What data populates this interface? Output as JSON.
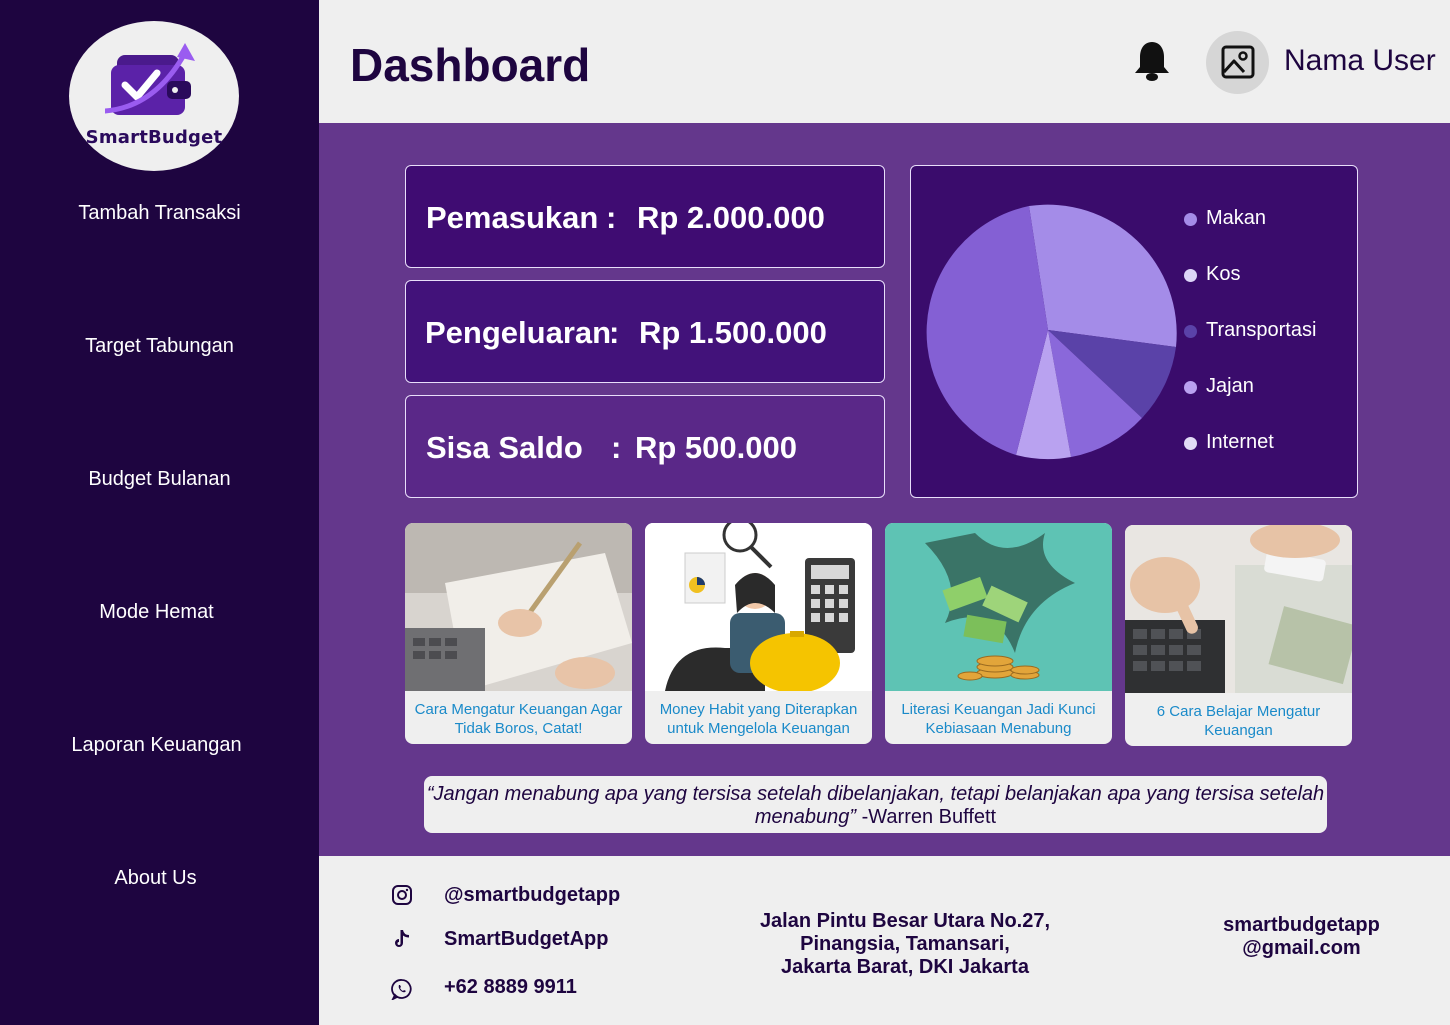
{
  "brand": {
    "name": "SmartBudget"
  },
  "sidebar": {
    "items": [
      {
        "label": "Tambah Transaksi"
      },
      {
        "label": "Target Tabungan"
      },
      {
        "label": "Budget Bulanan"
      },
      {
        "label": "Mode Hemat"
      },
      {
        "label": "Laporan Keuangan"
      },
      {
        "label": "About Us"
      }
    ]
  },
  "header": {
    "title": "Dashboard",
    "username": "Nama User"
  },
  "stats": {
    "income": {
      "label": "Pemasukan",
      "sep": ":",
      "value": "Rp 2.000.000"
    },
    "expense": {
      "label": "Pengeluaran",
      "sep": ":",
      "value": "Rp 1.500.000"
    },
    "balance": {
      "label": "Sisa Saldo",
      "sep": ":",
      "value": "Rp 500.000"
    }
  },
  "legend": [
    {
      "label": "Makan",
      "color": "#a48ce8"
    },
    {
      "label": "Kos",
      "color": "#ddd6f8"
    },
    {
      "label": "Transportasi",
      "color": "#5a42a8"
    },
    {
      "label": "Jajan",
      "color": "#b9a2f0"
    },
    {
      "label": "Internet",
      "color": "#e2dcf6"
    }
  ],
  "articles": [
    {
      "title": "Cara Mengatur Keuangan Agar Tidak Boros, Catat!"
    },
    {
      "title": "Money Habit yang Diterapkan untuk Mengelola Keuangan"
    },
    {
      "title": "Literasi Keuangan Jadi Kunci Kebiasaan Menabung"
    },
    {
      "title": "6 Cara Belajar Mengatur Keuangan"
    }
  ],
  "quote": {
    "text": "“Jangan menabung apa yang tersisa setelah dibelanjakan, tetapi belanjakan apa yang tersisa setelah menabung”",
    "author": " -Warren Buffett"
  },
  "footer": {
    "instagram": "@smartbudgetapp",
    "tiktok": "SmartBudgetApp",
    "whatsapp": "+62 8889 9911",
    "address_line1": "Jalan Pintu Besar Utara No.27,",
    "address_line2": "Pinangsia, Tamansari,",
    "address_line3": "Jakarta Barat, DKI Jakarta",
    "email_line1": "smartbudgetapp",
    "email_line2": "@gmail.com"
  },
  "icons": {
    "notification": "bell-icon",
    "avatar": "image-placeholder-icon",
    "instagram": "instagram-icon",
    "tiktok": "tiktok-icon",
    "whatsapp": "whatsapp-icon"
  },
  "colors": {
    "sidebar": "#1e0540",
    "main": "#64378c",
    "card": "#3a0c6c",
    "accent_link": "#1a8ac9"
  }
}
